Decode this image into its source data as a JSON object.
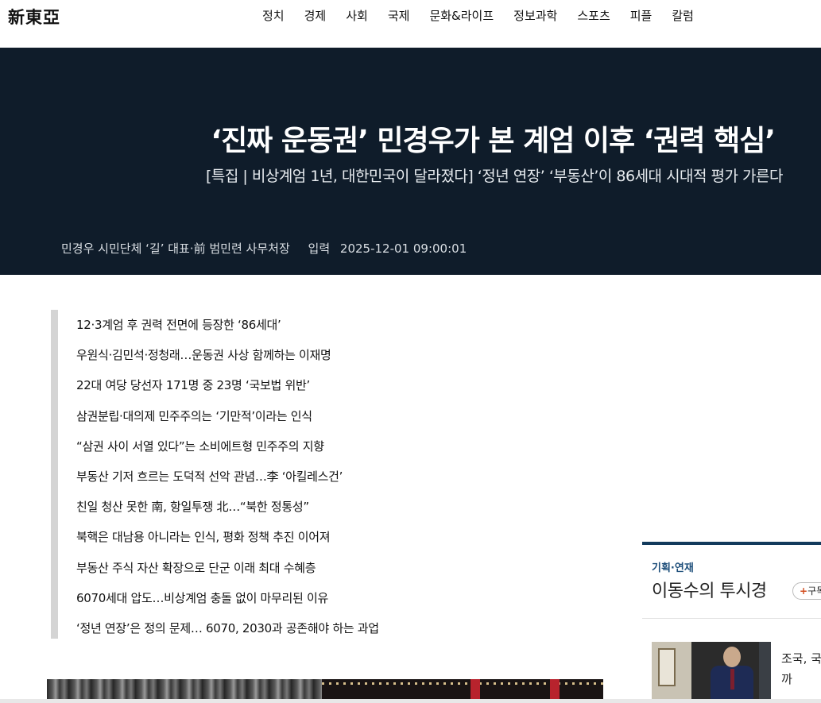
{
  "header": {
    "logo": "新東亞",
    "nav": [
      "정치",
      "경제",
      "사회",
      "국제",
      "문화&라이프",
      "정보과학",
      "스포츠",
      "피플",
      "칼럼"
    ]
  },
  "article": {
    "title": "‘진짜 운동권’ 민경우가 본 계엄 이후 ‘권력 핵심’",
    "subtitle": "[특집 | 비상계엄 1년, 대한민국이 달라졌다] ‘정년 연장’ ‘부동산’이 86세대 시대적 평가 가른다",
    "author": "민경우 시민단체 ‘길’ 대표·前 범민련 사무처장",
    "input_label": "입력",
    "date": "2025-12-01 09:00:01"
  },
  "summary": [
    "12·3계엄 후 권력 전면에 등장한 ‘86세대’",
    "우원식·김민석·정청래…운동권 사상 함께하는 이재명",
    "22대 여당 당선자 171명 중 23명 ‘국보법 위반’",
    "삼권분립·대의제 민주주의는 ‘기만적’이라는 인식",
    "“삼권 사이 서열 있다”는 소비에트형 민주주의 지향",
    "부동산 기저 흐르는 도덕적 선악 관념…李 ‘아킬레스건’",
    "친일 청산 못한 南, 항일투쟁 北…“북한 정통성”",
    "북핵은 대남용 아니라는 인식, 평화 정책 추진 이어져",
    "부동산 주식 자산 확장으로 단군 이래 최대 수혜층",
    "6070세대 압도…비상계엄 충돌 없이 마무리된 이유",
    "‘정년 연장’은 정의 문제… 6070, 2030과 공존해야 하는 과업"
  ],
  "sidebar": {
    "kicker": "기획·연재",
    "title": "이동수의 투시경",
    "subscribe_plus": "+",
    "subscribe_label": "구독",
    "article_line1": "조국, 국",
    "article_line2": "까"
  },
  "colors": {
    "hero_bg": "#0f1c2a",
    "accent_blue": "#1d4e7a",
    "subscribe_plus": "#d14b1c"
  }
}
